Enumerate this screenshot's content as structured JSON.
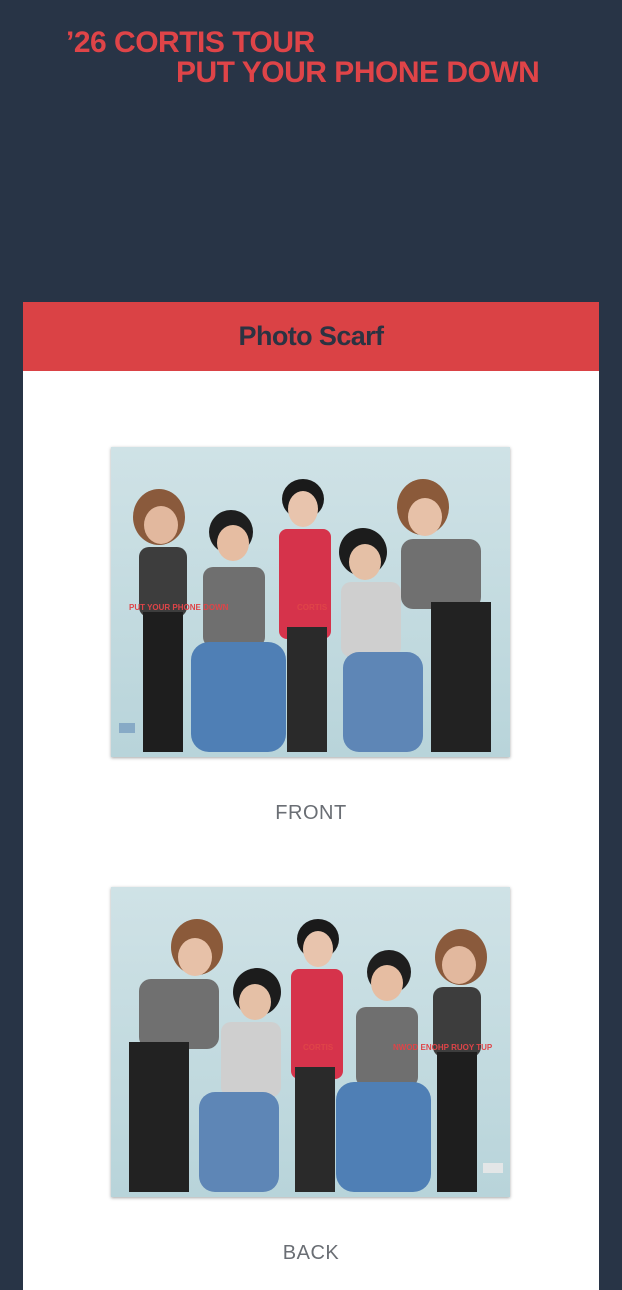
{
  "header": {
    "title_line1": "’26 CORTIS TOUR",
    "title_line2": "PUT YOUR PHONE DOWN"
  },
  "product": {
    "name": "Photo Scarf",
    "views": [
      {
        "label": "FRONT",
        "print_text_left": "PUT YOUR PHONE DOWN",
        "print_text_right": "CORTIS"
      },
      {
        "label": "BACK",
        "print_text_left": "CORTIS",
        "print_text_right": "NWOD ENOHP RUOY TUP"
      }
    ]
  },
  "colors": {
    "background": "#283446",
    "accent": "#df4448",
    "card": "#ffffff",
    "label_text": "#6a6e74"
  }
}
